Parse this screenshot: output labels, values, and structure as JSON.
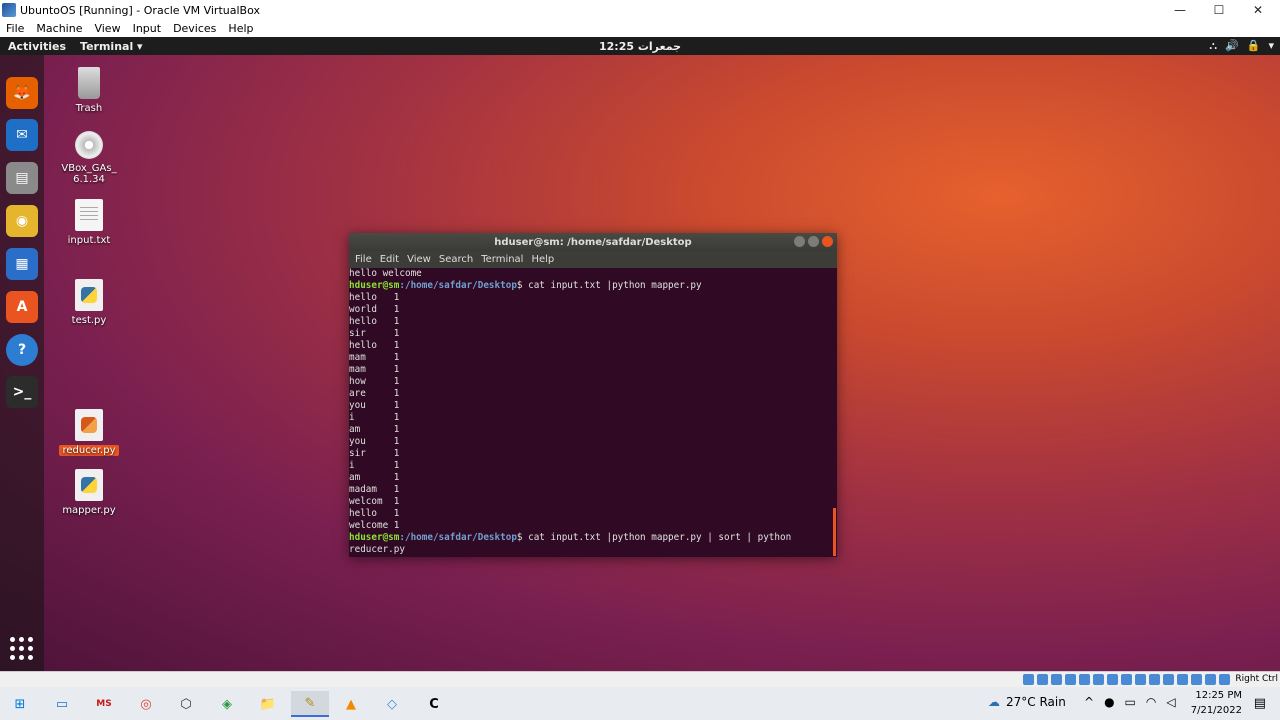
{
  "host_window": {
    "title": "UbuntoOS [Running] - Oracle VM VirtualBox",
    "menu": [
      "File",
      "Machine",
      "View",
      "Input",
      "Devices",
      "Help"
    ],
    "controls": {
      "minimize": "—",
      "maximize": "☐",
      "close": "✕"
    }
  },
  "gnome": {
    "activities": "Activities",
    "app_menu": "Terminal ▾",
    "clock": "جمعرات 12:25",
    "tray": [
      "⛬",
      "🔊",
      "🔒",
      "▾"
    ]
  },
  "dock": {
    "items": [
      {
        "name": "firefox",
        "glyph": "🦊",
        "color": "#e66000"
      },
      {
        "name": "thunderbird",
        "glyph": "✉",
        "color": "#1f6fc6"
      },
      {
        "name": "files",
        "glyph": "▤",
        "color": "#8a8a8a"
      },
      {
        "name": "rhythmbox",
        "glyph": "◉",
        "color": "#e6b52e"
      },
      {
        "name": "libreoffice-writer",
        "glyph": "▦",
        "color": "#2a6ec9"
      },
      {
        "name": "software-center",
        "glyph": "A",
        "color": "#e95420"
      },
      {
        "name": "help",
        "glyph": "?",
        "color": "#2d7dd2"
      },
      {
        "name": "terminal",
        "glyph": ">_",
        "color": "#2c2c2c"
      }
    ]
  },
  "desktop_icons": [
    {
      "label": "Trash"
    },
    {
      "label": "VBox_GAs_\n6.1.34"
    },
    {
      "label": "input.txt"
    },
    {
      "label": "test.py"
    },
    {
      "label": "reducer.py"
    },
    {
      "label": "mapper.py"
    }
  ],
  "terminal": {
    "title": "hduser@sm: /home/safdar/Desktop",
    "menu": [
      "File",
      "Edit",
      "View",
      "Search",
      "Terminal",
      "Help"
    ],
    "first_line": "hello welcome",
    "prompt_user": "hduser@sm",
    "prompt_path": ":/home/safdar/Desktop",
    "command1": "$ cat input.txt |python mapper.py",
    "output": [
      "hello   1",
      "world   1",
      "hello   1",
      "sir     1",
      "hello   1",
      "mam     1",
      "mam     1",
      "how     1",
      "are     1",
      "you     1",
      "i       1",
      "am      1",
      "you     1",
      "sir     1",
      "i       1",
      "am      1",
      "madam   1",
      "welcom  1",
      "hello   1",
      "welcome 1"
    ],
    "command2": "$ cat input.txt |python mapper.py | sort | python",
    "command2_wrap": "reducer.py"
  },
  "host_status": {
    "host_key": "Right Ctrl"
  },
  "taskbar": {
    "weather": "27°C Rain",
    "clock_time": "12:25 PM",
    "clock_date": "7/21/2022",
    "items": [
      "⊞",
      "▭",
      "MS",
      "◎",
      "⬡",
      "◈",
      "📁",
      "✎",
      "▲",
      "◇",
      "C"
    ]
  }
}
